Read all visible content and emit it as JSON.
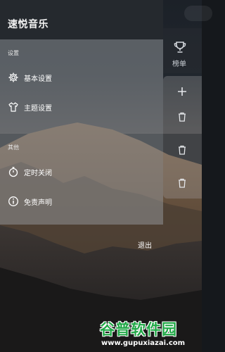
{
  "app": {
    "title": "速悦音乐"
  },
  "drawer": {
    "sections": [
      {
        "label": "设置",
        "items": [
          {
            "label": "基本设置",
            "icon": "gear-icon"
          },
          {
            "label": "主题设置",
            "icon": "shirt-icon"
          }
        ]
      },
      {
        "label": "其他",
        "items": [
          {
            "label": "定时关闭",
            "icon": "timer-icon"
          },
          {
            "label": "免责声明",
            "icon": "info-icon"
          }
        ]
      }
    ],
    "exit_label": "退出"
  },
  "right_panel": {
    "rank_label": "榜单",
    "rank_icon": "trophy-icon",
    "actions": [
      "plus-icon",
      "trash-icon",
      "trash-icon",
      "trash-icon"
    ]
  },
  "watermark": {
    "main": "谷普软件园",
    "url": "www.gupuxiazai.com"
  },
  "colors": {
    "drawer_header": "#25292e",
    "menu_panel": "rgba(150,153,158,0.50)",
    "watermark_green": "#21a847"
  }
}
